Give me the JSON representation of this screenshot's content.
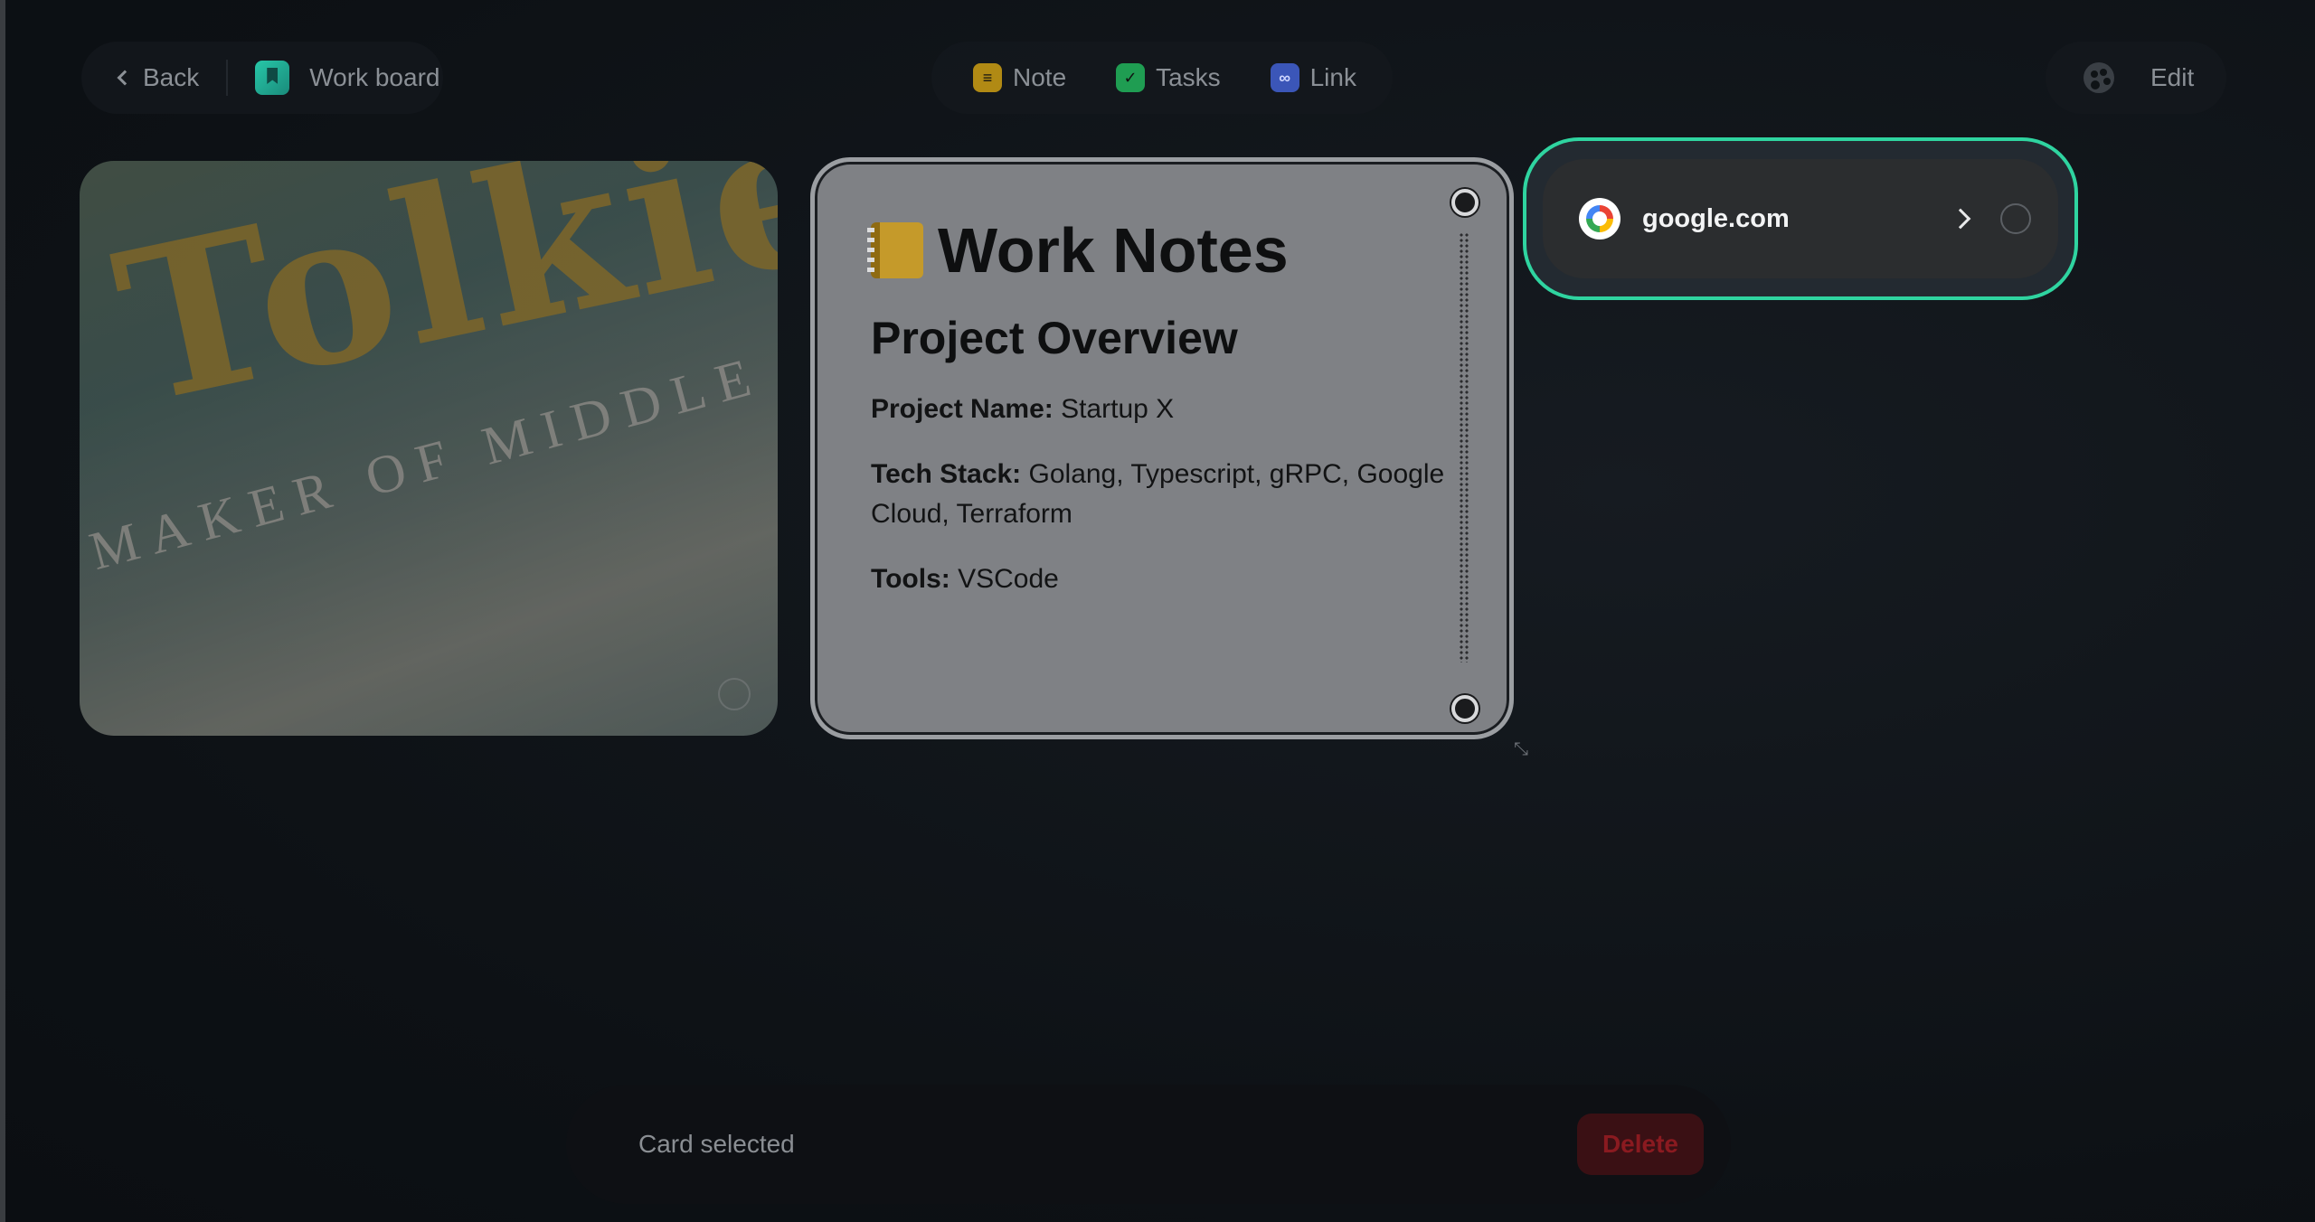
{
  "topbar": {
    "back_label": "Back",
    "board_name": "Work board",
    "tools": [
      {
        "label": "Note",
        "icon": "note-icon"
      },
      {
        "label": "Tasks",
        "icon": "check-icon"
      },
      {
        "label": "Link",
        "icon": "link-icon"
      }
    ],
    "edit_label": "Edit"
  },
  "image_card": {
    "title_text": "Tolkie",
    "subtitle_text": "MAKER OF MIDDLE"
  },
  "note_card": {
    "title": "Work Notes",
    "heading": "Project Overview",
    "rows": [
      {
        "key": "Project Name:",
        "value": " Startup X"
      },
      {
        "key": "Tech Stack:",
        "value": " Golang, Typescript, gRPC, Google Cloud, Terraform"
      },
      {
        "key": "Tools:",
        "value": " VSCode"
      }
    ]
  },
  "link_card": {
    "domain": "google.com"
  },
  "bottombar": {
    "status": "Card selected",
    "delete_label": "Delete"
  },
  "colors": {
    "accent_border": "#2fd4a0",
    "delete": "#8a1a20"
  }
}
